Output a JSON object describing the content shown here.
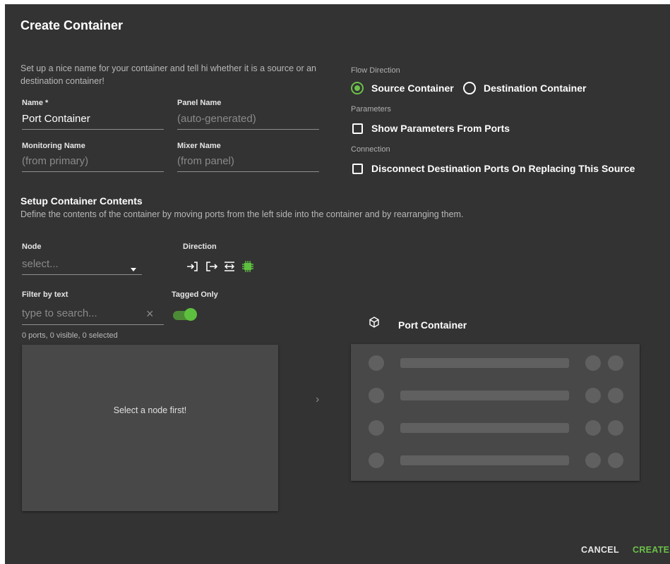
{
  "dialog": {
    "title": "Create Container",
    "description": "Set up a nice name for your container and tell hi whether it is a source or an destination container!"
  },
  "fields": {
    "name": {
      "label": "Name *",
      "value": "Port Container"
    },
    "panel_name": {
      "label": "Panel Name",
      "placeholder": "(auto-generated)"
    },
    "monitoring_name": {
      "label": "Monitoring Name",
      "placeholder": "(from primary)"
    },
    "mixer_name": {
      "label": "Mixer Name",
      "placeholder": "(from panel)"
    }
  },
  "flow": {
    "label": "Flow Direction",
    "options": [
      {
        "label": "Source Container",
        "selected": true
      },
      {
        "label": "Destination Container",
        "selected": false
      }
    ]
  },
  "parameters": {
    "label": "Parameters",
    "checkbox_label": "Show Parameters From Ports",
    "checked": false
  },
  "connection": {
    "label": "Connection",
    "checkbox_label": "Disconnect Destination Ports On Replacing This Source",
    "checked": false
  },
  "setup": {
    "title": "Setup Container Contents",
    "description": "Define the contents of the container by moving ports from the left side into the container and by rearranging them."
  },
  "node": {
    "label": "Node",
    "placeholder": "select..."
  },
  "direction": {
    "label": "Direction",
    "icons": [
      "input-icon",
      "output-icon",
      "bidirectional-icon",
      "chip-icon"
    ]
  },
  "filter": {
    "label": "Filter by text",
    "placeholder": "type to search..."
  },
  "tagged": {
    "label": "Tagged Only",
    "enabled": true
  },
  "ports_status": "0 ports, 0 visible, 0 selected",
  "left_panel": {
    "empty_text": "Select a node first!"
  },
  "transfer": {
    "arrow": "›"
  },
  "container_preview": {
    "title": "Port Container",
    "icon": "cube-icon",
    "rows": 4
  },
  "actions": {
    "cancel": "CANCEL",
    "create": "CREATE"
  },
  "colors": {
    "background": "#333333",
    "panel": "#484848",
    "accent": "#6cc04a",
    "placeholder_bar": "#606060"
  }
}
